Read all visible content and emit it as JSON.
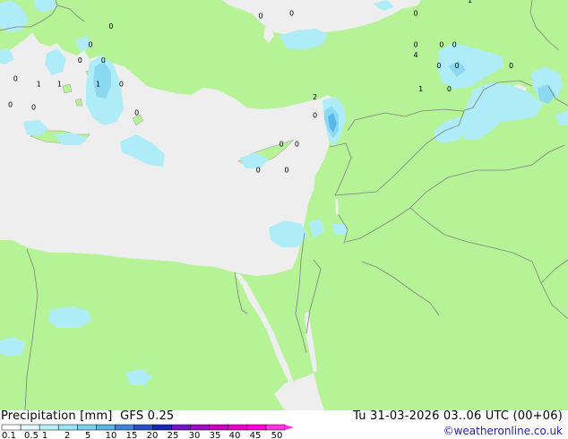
{
  "title": {
    "product": "Precipitation [mm]",
    "model": "GFS 0.25",
    "valid_time": "Tu 31-03-2026 03..06 UTC (00+06)"
  },
  "credit": "©weatheronline.co.uk",
  "legend": {
    "labels": [
      "0.1",
      "0.5",
      "1",
      "2",
      "5",
      "10",
      "15",
      "20",
      "25",
      "30",
      "35",
      "40",
      "45",
      "50"
    ],
    "colors": [
      "#ffffff",
      "#e0f8ff",
      "#b4f0fa",
      "#96e6f5",
      "#78d2f0",
      "#5ab4e6",
      "#3c82dc",
      "#2850c8",
      "#1428b4",
      "#7814c8",
      "#a00ac8",
      "#c800c8",
      "#e600d2",
      "#ff00dc",
      "#ff32e6"
    ]
  },
  "colors": {
    "land": "#b6f397",
    "sea": "#eeeeee",
    "border": "#808080",
    "precip_light": "#aeecf8",
    "precip_mid": "#8cd9f2",
    "precip_strong": "#5ab8e6"
  },
  "station_values": [
    {
      "label": "0",
      "lon": 30.1,
      "lat": 40.0
    },
    {
      "label": "0",
      "lon": 31.3,
      "lat": 40.1
    },
    {
      "label": "1",
      "lon": 38.2,
      "lat": 40.6
    },
    {
      "label": "0",
      "lon": 36.1,
      "lat": 40.1
    },
    {
      "label": "0",
      "lon": 36.1,
      "lat": 38.9
    },
    {
      "label": "0",
      "lon": 37.1,
      "lat": 38.9
    },
    {
      "label": "0",
      "lon": 37.6,
      "lat": 38.9
    },
    {
      "label": "4",
      "lon": 36.1,
      "lat": 38.5
    },
    {
      "label": "0",
      "lon": 37.0,
      "lat": 38.1
    },
    {
      "label": "0",
      "lon": 37.7,
      "lat": 38.1
    },
    {
      "label": "0",
      "lon": 39.8,
      "lat": 38.1
    },
    {
      "label": "1",
      "lon": 36.3,
      "lat": 37.2
    },
    {
      "label": "0",
      "lon": 37.4,
      "lat": 37.2
    },
    {
      "label": "2",
      "lon": 32.2,
      "lat": 36.9
    },
    {
      "label": "0",
      "lon": 32.2,
      "lat": 36.2
    },
    {
      "label": "0",
      "lon": 30.9,
      "lat": 35.1
    },
    {
      "label": "0",
      "lon": 31.5,
      "lat": 35.1
    },
    {
      "label": "0",
      "lon": 30.0,
      "lat": 34.1
    },
    {
      "label": "0",
      "lon": 31.1,
      "lat": 34.1
    },
    {
      "label": "0",
      "lon": 24.3,
      "lat": 39.6
    },
    {
      "label": "0",
      "lon": 23.5,
      "lat": 38.9
    },
    {
      "label": "0",
      "lon": 23.1,
      "lat": 38.3
    },
    {
      "label": "0",
      "lon": 24.0,
      "lat": 38.3
    },
    {
      "label": "0",
      "lon": 20.6,
      "lat": 37.6
    },
    {
      "label": "1",
      "lon": 21.5,
      "lat": 37.4
    },
    {
      "label": "1",
      "lon": 22.3,
      "lat": 37.4
    },
    {
      "label": "1",
      "lon": 23.8,
      "lat": 37.4
    },
    {
      "label": "0",
      "lon": 24.7,
      "lat": 37.4
    },
    {
      "label": "0",
      "lon": 20.4,
      "lat": 36.6
    },
    {
      "label": "0",
      "lon": 21.3,
      "lat": 36.5
    },
    {
      "label": "0",
      "lon": 25.3,
      "lat": 36.3
    }
  ]
}
